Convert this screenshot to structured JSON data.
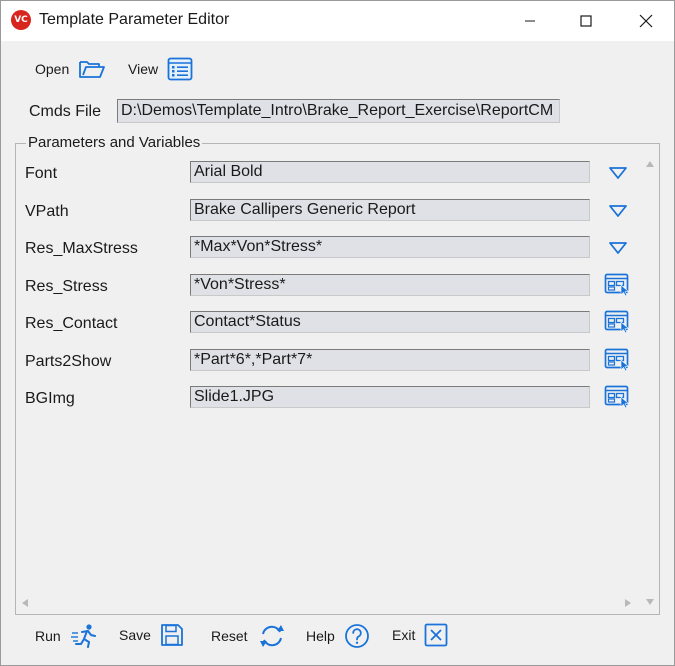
{
  "window": {
    "title": "Template Parameter Editor",
    "app_icon_text": "VC",
    "accent_color": "#1a73d9"
  },
  "toolbar": {
    "open_label": "Open",
    "view_label": "View"
  },
  "cmds_file": {
    "label": "Cmds File",
    "value": "D:\\Demos\\Template_Intro\\Brake_Report_Exercise\\ReportCM"
  },
  "parameters": {
    "title": "Parameters and Variables",
    "rows": [
      {
        "name": "Font",
        "value": "Arial Bold",
        "button_icon": "dropdown-triangle-icon"
      },
      {
        "name": "VPath",
        "value": "Brake Callipers Generic Report",
        "button_icon": "dropdown-triangle-icon"
      },
      {
        "name": "Res_MaxStress",
        "value": "*Max*Von*Stress*",
        "button_icon": "dropdown-triangle-icon"
      },
      {
        "name": "Res_Stress",
        "value": "*Von*Stress*",
        "button_icon": "select-window-icon"
      },
      {
        "name": "Res_Contact",
        "value": "Contact*Status",
        "button_icon": "select-window-icon"
      },
      {
        "name": "Parts2Show",
        "value": "*Part*6*,*Part*7*",
        "button_icon": "select-window-icon"
      },
      {
        "name": "BGImg",
        "value": "Slide1.JPG",
        "button_icon": "select-window-icon"
      }
    ]
  },
  "bottom_bar": {
    "run_label": "Run",
    "save_label": "Save",
    "reset_label": "Reset",
    "help_label": "Help",
    "exit_label": "Exit"
  }
}
